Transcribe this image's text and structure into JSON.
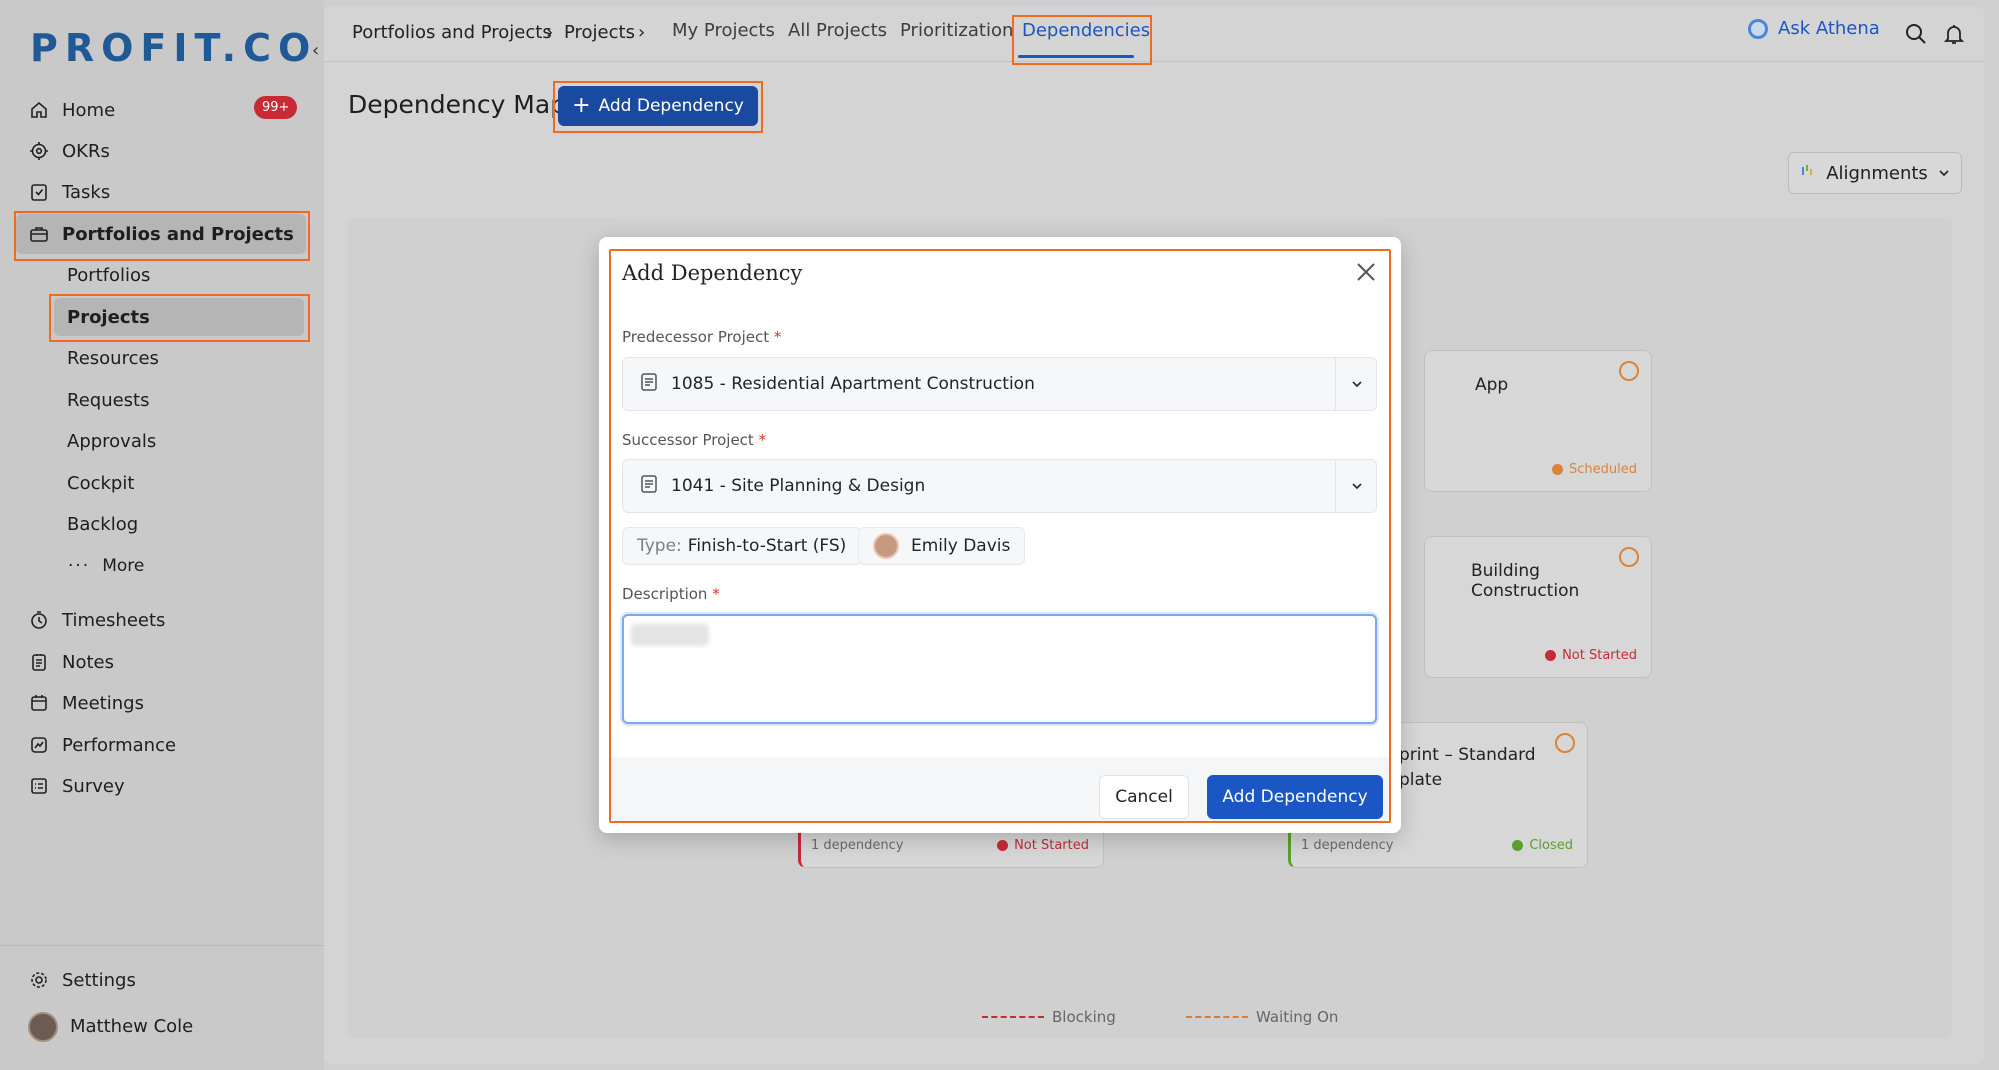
{
  "app": {
    "logo": "PROFIT.CO",
    "brand_color": "#1f5a96",
    "accent_color": "#1a56c4",
    "highlight_color": "#f06a1f"
  },
  "sidebar": {
    "badge": "99+",
    "items": [
      {
        "label": "Home",
        "icon": "home-icon"
      },
      {
        "label": "OKRs",
        "icon": "target-icon"
      },
      {
        "label": "Tasks",
        "icon": "task-icon"
      },
      {
        "label": "Portfolios and Projects",
        "icon": "briefcase-icon"
      }
    ],
    "sub_items": [
      "Portfolios",
      "Projects",
      "Resources",
      "Requests",
      "Approvals",
      "Cockpit",
      "Backlog"
    ],
    "more_label": "More",
    "items2": [
      {
        "label": "Timesheets",
        "icon": "timer-icon"
      },
      {
        "label": "Notes",
        "icon": "notes-icon"
      },
      {
        "label": "Meetings",
        "icon": "calendar-icon"
      },
      {
        "label": "Performance",
        "icon": "performance-icon"
      },
      {
        "label": "Survey",
        "icon": "survey-icon"
      }
    ],
    "settings_label": "Settings",
    "user_name": "Matthew Cole"
  },
  "header": {
    "breadcrumb": [
      "Portfolios and Projects",
      "Projects"
    ],
    "tabs": [
      "My Projects",
      "All Projects",
      "Prioritization",
      "Dependencies"
    ],
    "active_tab": "Dependencies",
    "ask_label": "Ask Athena"
  },
  "page": {
    "title": "Dependency Map",
    "add_button": "Add Dependency",
    "alignments_label": "Alignments"
  },
  "cards": [
    {
      "title": "App",
      "status": "Scheduled",
      "status_color": "#d8843a"
    },
    {
      "title": "Building Construction",
      "status": "Not Started",
      "status_color": "#c62b36"
    },
    {
      "title_line1": "print – Standard",
      "title_line2": "plate",
      "dependency": "1 dependency",
      "status": "Closed",
      "status_color": "#5aa02c"
    },
    {
      "dependency": "1 dependency",
      "status": "Not Started",
      "status_color": "#c62b36"
    }
  ],
  "legend": {
    "blocking": "Blocking",
    "waiting": "Waiting On"
  },
  "modal": {
    "title": "Add Dependency",
    "predecessor_label": "Predecessor Project",
    "predecessor_value": "1085 - Residential Apartment Construction",
    "successor_label": "Successor Project",
    "successor_value": "1041 - Site Planning & Design",
    "required_mark": "*",
    "type_label": "Type:",
    "type_value": "Finish-to-Start (FS)",
    "assignee": "Emily Davis",
    "description_label": "Description",
    "cancel_label": "Cancel",
    "submit_label": "Add Dependency"
  }
}
